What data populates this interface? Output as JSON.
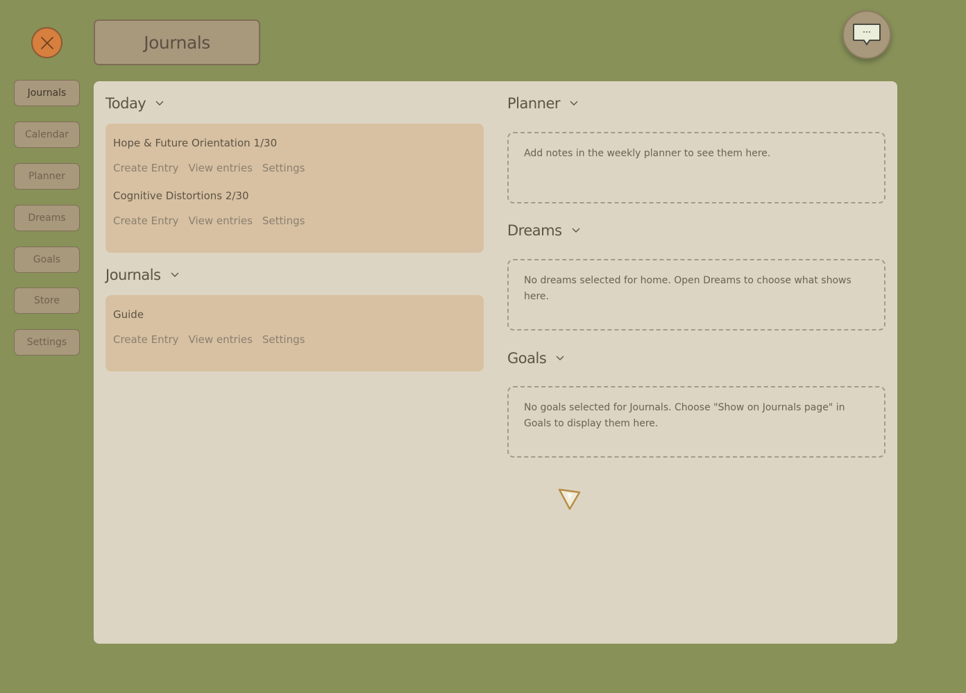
{
  "header": {
    "title": "Journals"
  },
  "sidebar": {
    "items": [
      {
        "label": "Journals"
      },
      {
        "label": "Calendar"
      },
      {
        "label": "Planner"
      },
      {
        "label": "Dreams"
      },
      {
        "label": "Goals"
      },
      {
        "label": "Store"
      },
      {
        "label": "Settings"
      }
    ]
  },
  "today": {
    "heading": "Today",
    "journals": [
      {
        "name": "Hope & Future Orientation 1/30",
        "create": "Create Entry",
        "view": "View entries",
        "settings": "Settings"
      },
      {
        "name": "Cognitive Distortions 2/30",
        "create": "Create Entry",
        "view": "View entries",
        "settings": "Settings"
      }
    ]
  },
  "journals_section": {
    "heading": "Journals",
    "journals": [
      {
        "name": "Guide",
        "create": "Create Entry",
        "view": "View entries",
        "settings": "Settings"
      }
    ]
  },
  "planner": {
    "heading": "Planner",
    "empty_text": "Add notes in the weekly planner to see them here."
  },
  "dreams": {
    "heading": "Dreams",
    "empty_text": "No dreams selected for home. Open Dreams to choose what shows here."
  },
  "goals": {
    "heading": "Goals",
    "empty_text": "No goals selected for Journals. Choose \"Show on Journals page\" in Goals to display them here."
  },
  "colors": {
    "background": "#879158",
    "panel": "#ddd5c3",
    "card": "#d7c1a2",
    "button": "#a8987c",
    "close_button": "#d77f3e"
  },
  "icons": {
    "close": "close-icon",
    "chat": "chat-bubble-icon",
    "chevron": "chevron-down-icon",
    "cursor": "pointer-cursor-icon"
  }
}
